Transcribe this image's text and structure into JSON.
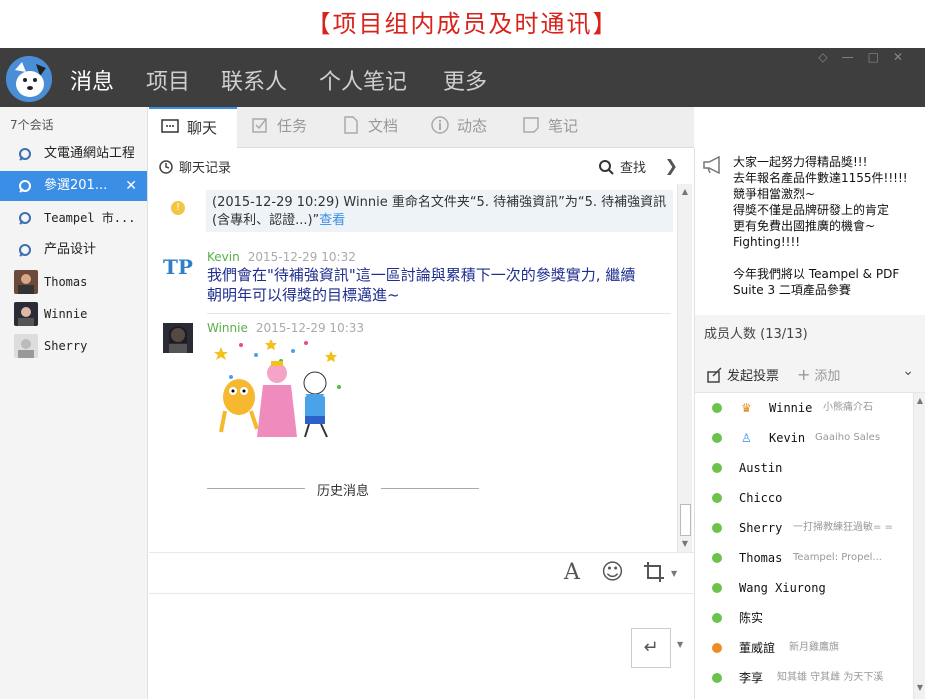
{
  "banner": {
    "title": "【项目组内成员及时通讯】"
  },
  "nav": {
    "items": [
      {
        "label": "消息",
        "active": true
      },
      {
        "label": "项目",
        "active": false
      },
      {
        "label": "联系人",
        "active": false
      },
      {
        "label": "个人笔记",
        "active": false
      },
      {
        "label": "更多",
        "active": false
      }
    ]
  },
  "sidebar": {
    "count_label": "7个会话",
    "sessions": [
      {
        "label": "文電通網站工程",
        "type": "group",
        "active": false
      },
      {
        "label": "參選201...",
        "type": "group",
        "active": true
      },
      {
        "label": "Teampel 市...",
        "type": "group",
        "active": false
      },
      {
        "label": "产品设计",
        "type": "group",
        "active": false
      },
      {
        "label": "Thomas",
        "type": "user",
        "active": false
      },
      {
        "label": "Winnie",
        "type": "user",
        "active": false
      },
      {
        "label": "Sherry",
        "type": "user",
        "active": false
      }
    ],
    "close_glyph": "✕"
  },
  "tabs": [
    {
      "label": "聊天",
      "active": true
    },
    {
      "label": "任务",
      "active": false
    },
    {
      "label": "文档",
      "active": false
    },
    {
      "label": "动态",
      "active": false
    },
    {
      "label": "笔记",
      "active": false
    }
  ],
  "chat_bar": {
    "history_label": "聊天记录",
    "search_label": "查找"
  },
  "messages": {
    "notice": {
      "text": "(2015-12-29 10:29) Winnie 重命名文件夹“5. 待補強資訊”为“5. 待補強資訊(含專利、認證...)”",
      "link": "查看"
    },
    "items": [
      {
        "sender": "Kevin",
        "time": "2015-12-29 10:32",
        "text_line1": "我們會在\"待補強資訊\"這一區討論與累積下一次的參獎實力, 繼續",
        "text_line2": "朝明年可以得獎的目標邁進~"
      },
      {
        "sender": "Winnie",
        "time": "2015-12-29 10:33"
      }
    ],
    "history_label": "历史消息"
  },
  "right": {
    "announcement": "大家一起努力得精品獎!!!\n去年報名產品件數達1155件!!!!!\n競爭相當激烈~\n得獎不僅是品牌研發上的肯定\n更有免費出國推廣的機會~\nFighting!!!!\n\n今年我們將以 Teampel & PDF Suite 3 二項產品參賽",
    "member_header": "成员人数 (13/13)",
    "vote_label": "发起投票",
    "add_label": "添加",
    "members": [
      {
        "name": "Winnie",
        "role": "owner",
        "signature": "小熊痛介石",
        "status": "online"
      },
      {
        "name": "Kevin",
        "role": "admin",
        "signature": "Gaaiho Sales",
        "status": "online"
      },
      {
        "name": "Austin",
        "role": "",
        "signature": "",
        "status": "online"
      },
      {
        "name": "Chicco",
        "role": "",
        "signature": "",
        "status": "online"
      },
      {
        "name": "Sherry",
        "role": "",
        "signature": "一打掃教練狂過敏= =",
        "status": "online"
      },
      {
        "name": "Thomas",
        "role": "",
        "signature": "Teampel: Propel...",
        "status": "online"
      },
      {
        "name": "Wang Xiurong",
        "role": "",
        "signature": "",
        "status": "online"
      },
      {
        "name": "陈实",
        "role": "",
        "signature": "",
        "status": "online"
      },
      {
        "name": "董威誼",
        "role": "",
        "signature": "新月雞鷹旗",
        "status": "away"
      },
      {
        "name": "李享",
        "role": "",
        "signature": "知其雄 守其雌 为天下溪",
        "status": "online"
      }
    ]
  },
  "colors": {
    "accent": "#3a8ee6",
    "nav_bg": "#3e3e3e",
    "banner_red": "#d8221c",
    "online": "#6cc24a",
    "away": "#f08a24"
  }
}
